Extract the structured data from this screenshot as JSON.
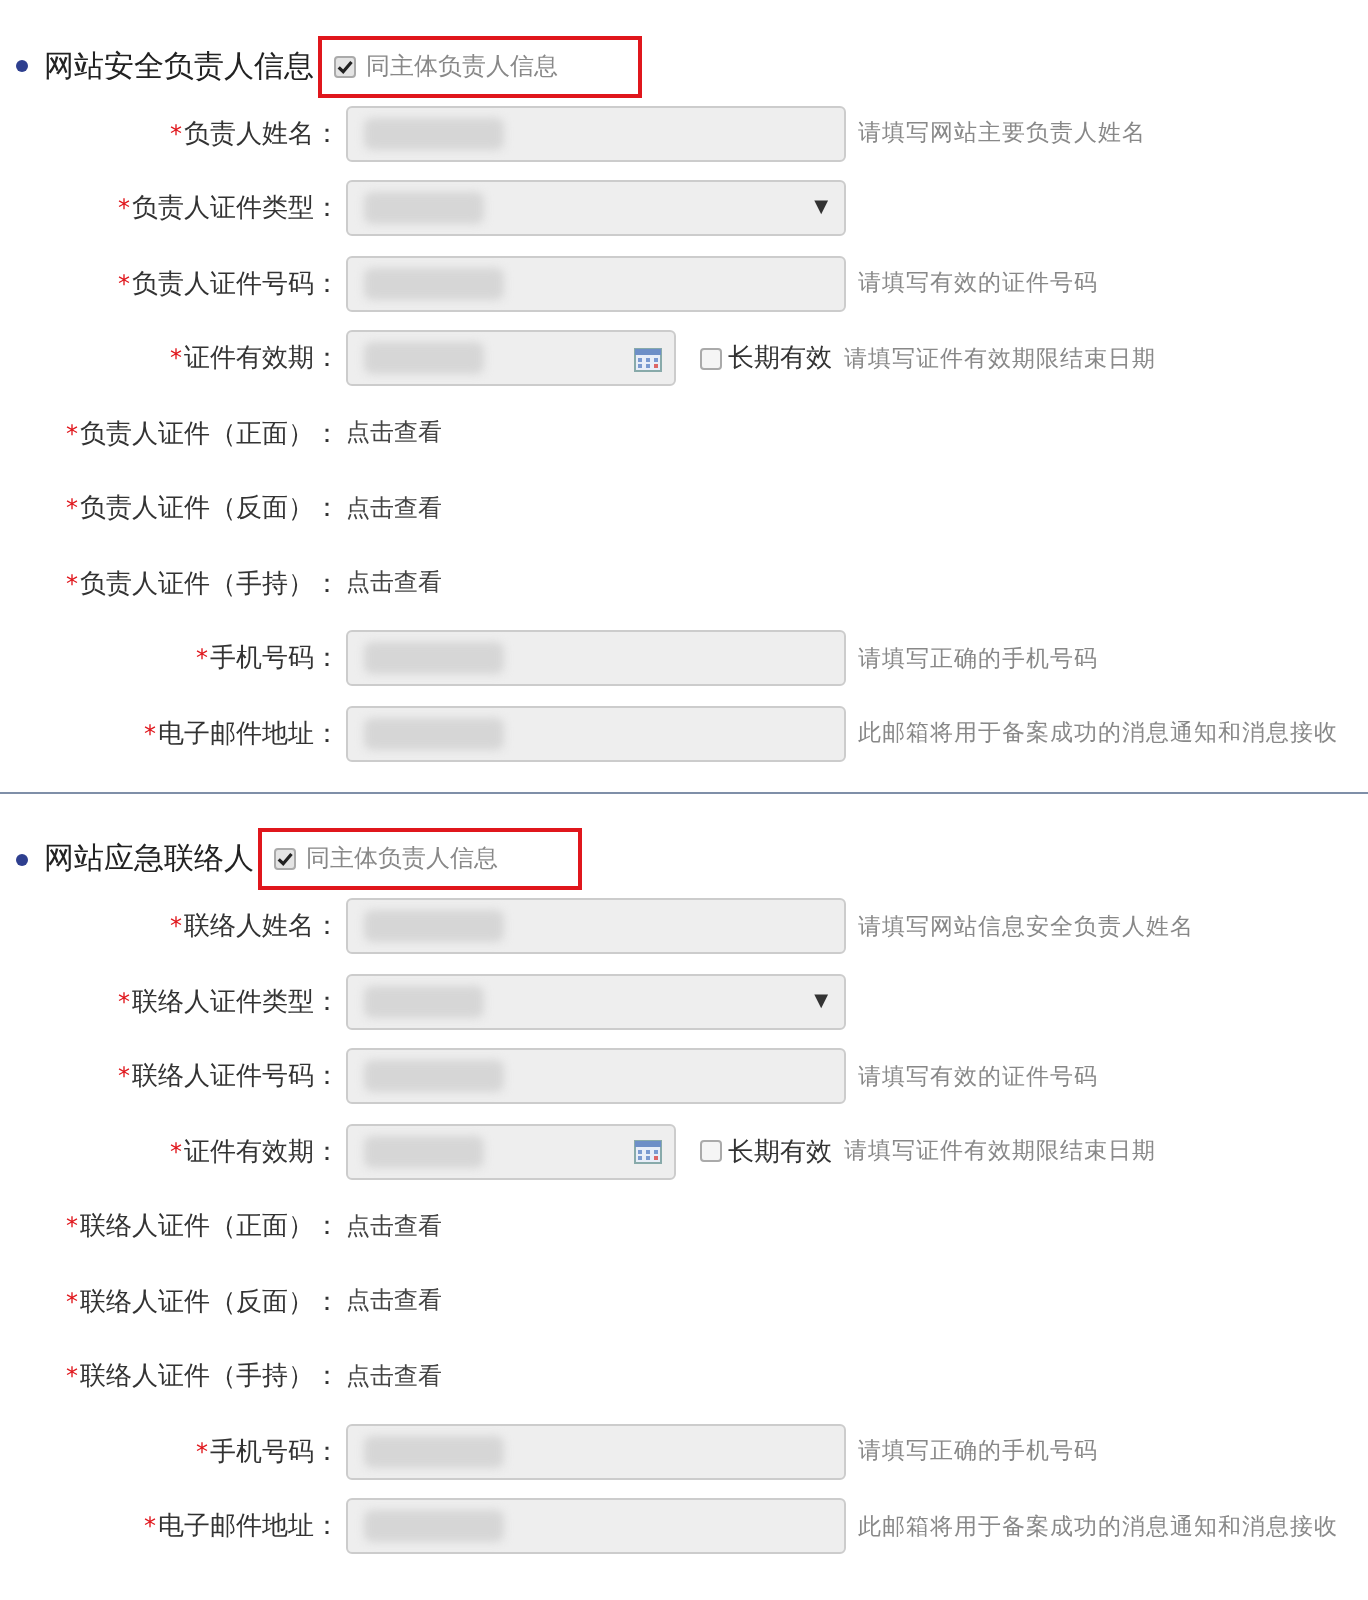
{
  "sections": [
    {
      "title": "网站安全负责人信息",
      "same_as": {
        "label": "同主体负责人信息",
        "checked": true,
        "highlighted": true
      },
      "rows": [
        {
          "kind": "input",
          "mark": "*",
          "label": "负责人姓名：",
          "hint": "请填写网站主要负责人姓名"
        },
        {
          "kind": "select",
          "mark": "*",
          "label": "负责人证件类型：",
          "arrow": "▼"
        },
        {
          "kind": "input",
          "mark": "*",
          "label": "负责人证件号码：",
          "hint": "请填写有效的证件号码"
        },
        {
          "kind": "date",
          "mark": "*",
          "label": "证件有效期：",
          "option": {
            "label": "长期有效",
            "checked": false
          },
          "hint": "请填写证件有效期限结束日期"
        },
        {
          "kind": "link",
          "mark": "*",
          "label": "负责人证件（正面）：",
          "link": "点击查看"
        },
        {
          "kind": "link",
          "mark": "*",
          "label": "负责人证件（反面）：",
          "link": "点击查看"
        },
        {
          "kind": "link",
          "mark": "*",
          "label": "负责人证件（手持）：",
          "link": "点击查看"
        },
        {
          "kind": "input",
          "mark": "*",
          "label": "手机号码：",
          "hint": "请填写正确的手机号码"
        },
        {
          "kind": "input",
          "mark": "*",
          "label": "电子邮件地址：",
          "hint": "此邮箱将用于备案成功的消息通知和消息接收"
        }
      ]
    },
    {
      "title": "网站应急联络人",
      "same_as": {
        "label": "同主体负责人信息",
        "checked": true,
        "highlighted": true
      },
      "rows": [
        {
          "kind": "input",
          "mark": "*",
          "label": "联络人姓名：",
          "hint": "请填写网站信息安全负责人姓名"
        },
        {
          "kind": "select",
          "mark": "*",
          "label": "联络人证件类型：",
          "arrow": "▼"
        },
        {
          "kind": "input",
          "mark": "*",
          "label": "联络人证件号码：",
          "hint": "请填写有效的证件号码"
        },
        {
          "kind": "date",
          "mark": "*",
          "label": "证件有效期：",
          "option": {
            "label": "长期有效",
            "checked": false
          },
          "hint": "请填写证件有效期限结束日期"
        },
        {
          "kind": "link",
          "mark": "*",
          "label": "联络人证件（正面）：",
          "link": "点击查看"
        },
        {
          "kind": "link",
          "mark": "*",
          "label": "联络人证件（反面）：",
          "link": "点击查看"
        },
        {
          "kind": "link",
          "mark": "*",
          "label": "联络人证件（手持）：",
          "link": "点击查看"
        },
        {
          "kind": "input",
          "mark": "*",
          "label": "手机号码：",
          "hint": "请填写正确的手机号码"
        },
        {
          "kind": "input",
          "mark": "*",
          "label": "电子邮件地址：",
          "hint": "此邮箱将用于备案成功的消息通知和消息接收"
        }
      ]
    }
  ]
}
